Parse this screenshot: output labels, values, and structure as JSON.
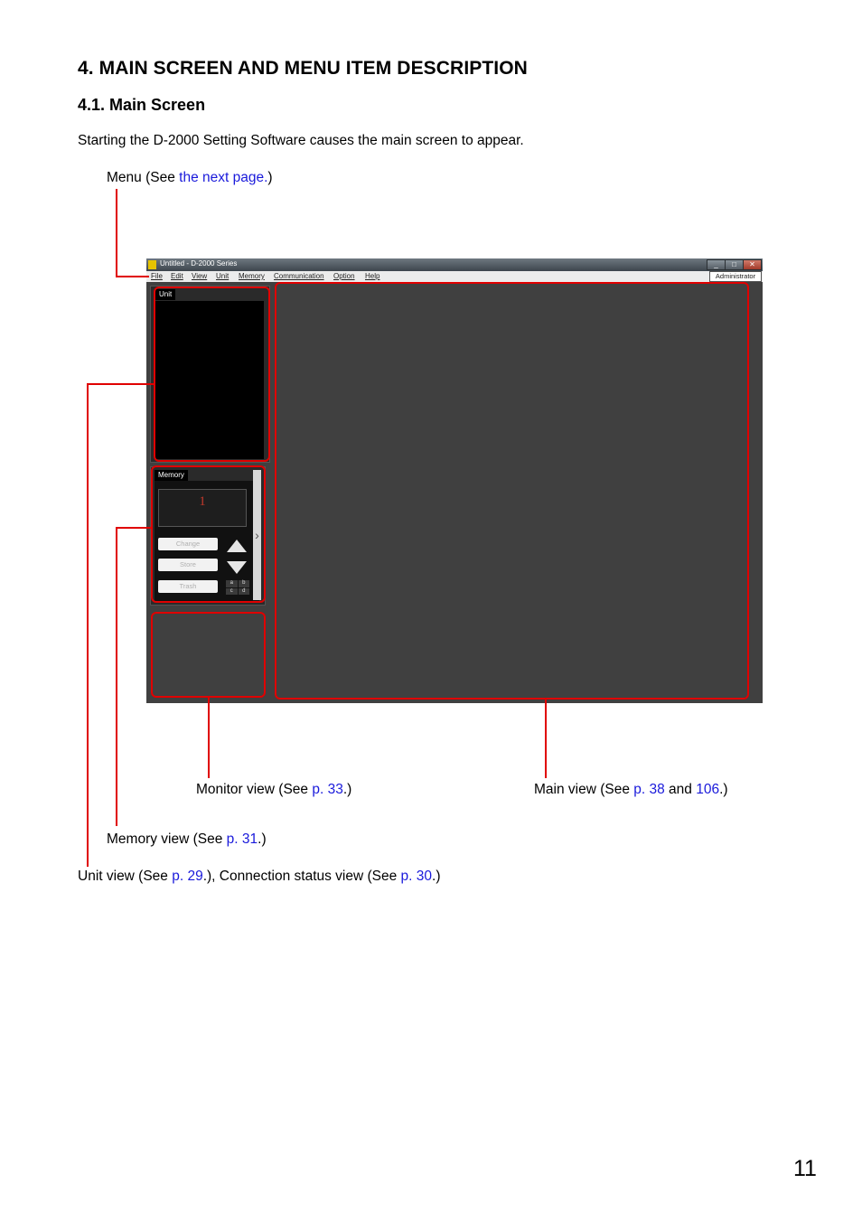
{
  "heading": "4. MAIN SCREEN AND MENU ITEM DESCRIPTION",
  "subheading": "4.1. Main Screen",
  "intro": "Starting the D-2000 Setting Software causes the main screen to appear.",
  "callouts": {
    "menu": {
      "pre": "Menu (See ",
      "link": "the next page.",
      "post": ")"
    },
    "monitor": {
      "pre": "Monitor view (See ",
      "link": "p. 33",
      "post": ".)"
    },
    "main": {
      "pre": "Main view (See ",
      "link1": "p. 38",
      "mid": " and ",
      "link2": "106",
      "post": ".)"
    },
    "memory": {
      "pre": "Memory view (See ",
      "link": "p. 31",
      "post": ".)"
    },
    "unit": {
      "pre": "Unit view (See ",
      "link1": "p. 29",
      "mid": ".), Connection status view (See ",
      "link2": "p. 30",
      "post": ".)"
    }
  },
  "window": {
    "title": "Untitled - D-2000 Series",
    "controls": {
      "minimize": "_",
      "maximize": "□",
      "close": "✕"
    },
    "menu": [
      "File",
      "Edit",
      "View",
      "Unit",
      "Memory",
      "Communication",
      "Option",
      "Help"
    ],
    "user": "Administrator",
    "unit_tab": "Unit",
    "memory_tab": "Memory",
    "memory_number": "1",
    "buttons": {
      "change": "Change",
      "store": "Store",
      "trash": "Trash"
    },
    "bank": [
      "a",
      "b",
      "c",
      "d"
    ],
    "expand_arrow": "›"
  },
  "colors": {
    "callout": "#e00000",
    "link": "#1a1adb",
    "window_bg": "#404040"
  },
  "page_number": "11"
}
